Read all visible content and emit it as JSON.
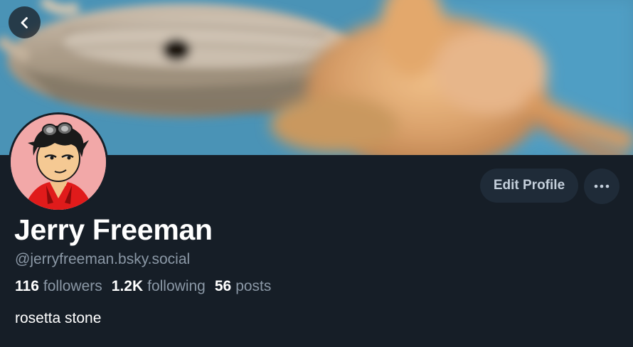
{
  "profile": {
    "display_name": "Jerry Freeman",
    "handle": "@jerryfreeman.bsky.social",
    "bio": "rosetta stone"
  },
  "stats": {
    "followers_count": "116",
    "followers_label": "followers",
    "following_count": "1.2K",
    "following_label": "following",
    "posts_count": "56",
    "posts_label": "posts"
  },
  "actions": {
    "edit_profile_label": "Edit Profile"
  },
  "icons": {
    "back": "chevron-left-icon",
    "more": "more-horizontal-icon"
  },
  "colors": {
    "background": "#161e27",
    "button_bg": "#1f2b38",
    "text_primary": "#ffffff",
    "text_secondary": "#8b98a6"
  }
}
